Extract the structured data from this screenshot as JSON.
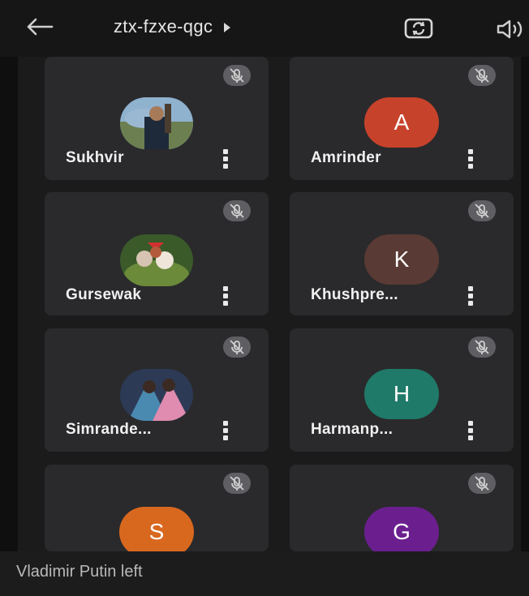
{
  "header": {
    "meeting_code": "ztx-fzxe-qgc"
  },
  "participants": [
    {
      "name": "Sukhvir",
      "avatar": "photo",
      "muted": true
    },
    {
      "name": "Amrinder",
      "avatar": "letter",
      "initial": "A",
      "avatar_color": "#c7422b",
      "muted": true
    },
    {
      "name": "Gursewak",
      "avatar": "photo",
      "muted": true
    },
    {
      "name": "Khushpre...",
      "avatar": "letter",
      "initial": "K",
      "avatar_color": "#5a3a34",
      "muted": true
    },
    {
      "name": "Simrande...",
      "avatar": "photo",
      "muted": true
    },
    {
      "name": "Harmanp...",
      "avatar": "letter",
      "initial": "H",
      "avatar_color": "#1f7a69",
      "muted": true
    },
    {
      "name": "",
      "avatar": "letter",
      "initial": "S",
      "avatar_color": "#d9681f",
      "muted": true
    },
    {
      "name": "",
      "avatar": "letter",
      "initial": "G",
      "avatar_color": "#6b1f8f",
      "muted": true
    }
  ],
  "toast": {
    "message": "Vladimir Putin left"
  },
  "icons": {
    "back": "arrow-left-icon",
    "switch_camera": "switch-camera-icon",
    "speaker": "speaker-icon",
    "mute": "mic-off-icon",
    "more": "more-vert-icon"
  }
}
